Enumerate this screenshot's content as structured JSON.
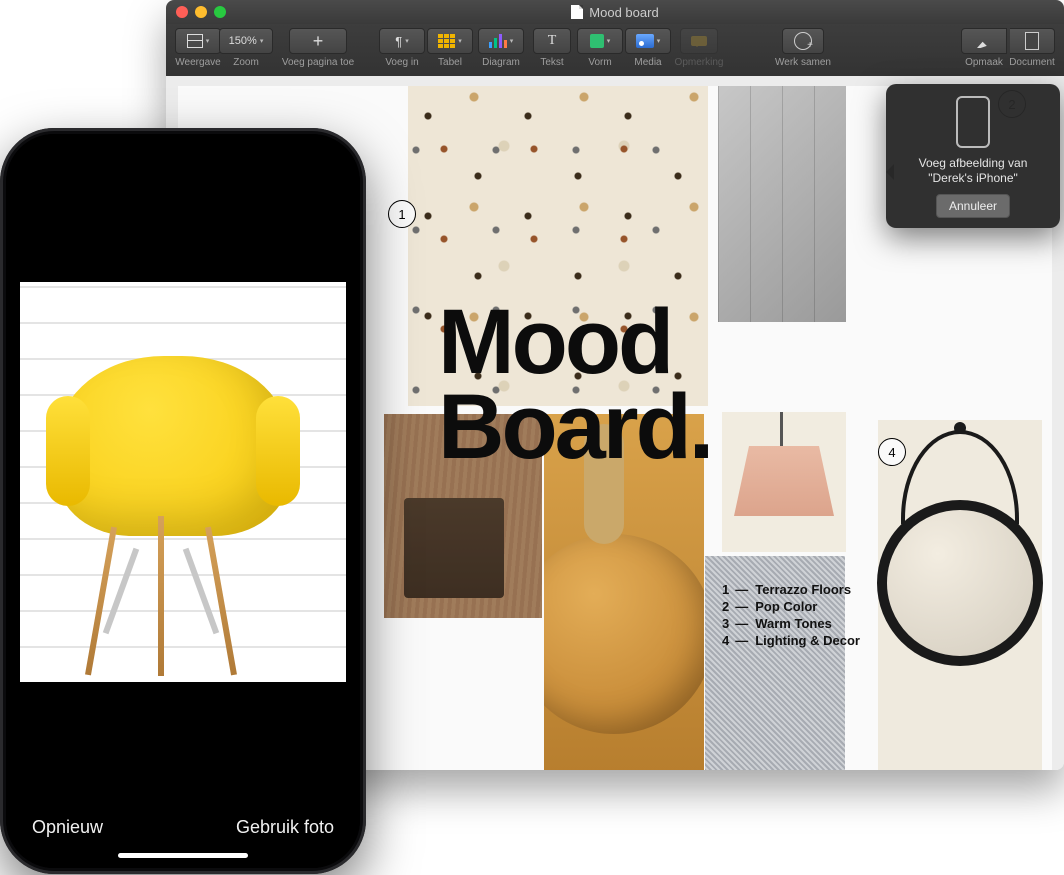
{
  "mac": {
    "title": "Mood board",
    "toolbar": {
      "view_label": "Weergave",
      "zoom_value": "150%",
      "zoom_label": "Zoom",
      "addpage_label": "Voeg pagina toe",
      "insert_label": "Voeg in",
      "table_label": "Tabel",
      "chart_label": "Diagram",
      "text_label": "Tekst",
      "text_glyph": "T",
      "shape_label": "Vorm",
      "media_label": "Media",
      "comment_label": "Opmerking",
      "collab_label": "Werk samen",
      "format_label": "Opmaak",
      "document_label": "Document",
      "plus_glyph": "+",
      "pilcrow_glyph": "¶",
      "chevron": "▾"
    },
    "page": {
      "headline_l1": "Mood",
      "headline_l2": "Board.",
      "callouts": {
        "c1": "1",
        "c2": "2",
        "c4": "4"
      },
      "legend": [
        {
          "n": "1",
          "t": "Terrazzo Floors"
        },
        {
          "n": "2",
          "t": "Pop Color"
        },
        {
          "n": "3",
          "t": "Warm Tones"
        },
        {
          "n": "4",
          "t": "Lighting & Decor"
        }
      ]
    },
    "popover": {
      "line1": "Voeg afbeelding van",
      "line2": "\"Derek's iPhone\"",
      "cancel": "Annuleer"
    }
  },
  "phone": {
    "retake": "Opnieuw",
    "use_photo": "Gebruik foto"
  }
}
